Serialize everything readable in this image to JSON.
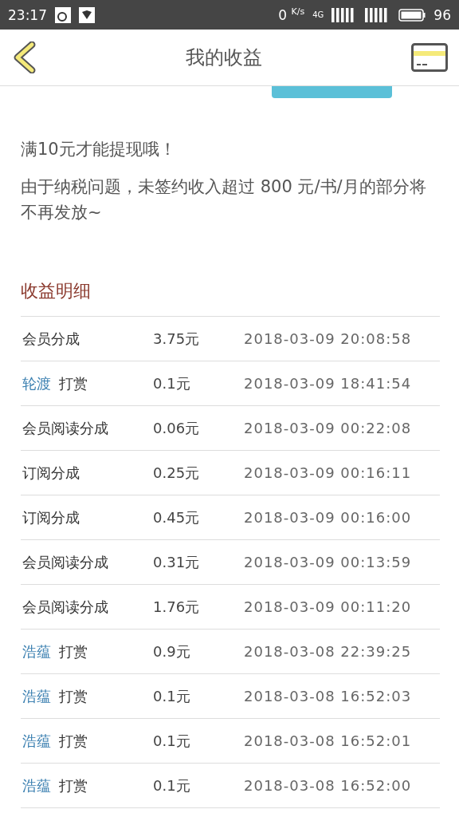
{
  "status_bar": {
    "time": "23:17",
    "speed": "0",
    "speed_unit": "K/s",
    "network": "4G",
    "battery": "96"
  },
  "header": {
    "title": "我的收益"
  },
  "notes": [
    "满10元才能提现哦！",
    "由于纳税问题，未签约收入超过 800 元/书/月的部分将不再发放~"
  ],
  "section_title": "收益明细",
  "rows": [
    {
      "kind": "plain",
      "label": "会员分成",
      "amount": "3.75元",
      "time": "2018-03-09 20:08:58"
    },
    {
      "kind": "reward",
      "user": "轮渡",
      "label": "打赏",
      "amount": "0.1元",
      "time": "2018-03-09 18:41:54"
    },
    {
      "kind": "plain",
      "label": "会员阅读分成",
      "amount": "0.06元",
      "time": "2018-03-09 00:22:08"
    },
    {
      "kind": "plain",
      "label": "订阅分成",
      "amount": "0.25元",
      "time": "2018-03-09 00:16:11"
    },
    {
      "kind": "plain",
      "label": "订阅分成",
      "amount": "0.45元",
      "time": "2018-03-09 00:16:00"
    },
    {
      "kind": "plain",
      "label": "会员阅读分成",
      "amount": "0.31元",
      "time": "2018-03-09 00:13:59"
    },
    {
      "kind": "plain",
      "label": "会员阅读分成",
      "amount": "1.76元",
      "time": "2018-03-09 00:11:20"
    },
    {
      "kind": "reward",
      "user": "浩蕴",
      "label": "打赏",
      "amount": "0.9元",
      "time": "2018-03-08 22:39:25"
    },
    {
      "kind": "reward",
      "user": "浩蕴",
      "label": "打赏",
      "amount": "0.1元",
      "time": "2018-03-08 16:52:03"
    },
    {
      "kind": "reward",
      "user": "浩蕴",
      "label": "打赏",
      "amount": "0.1元",
      "time": "2018-03-08 16:52:01"
    },
    {
      "kind": "reward",
      "user": "浩蕴",
      "label": "打赏",
      "amount": "0.1元",
      "time": "2018-03-08 16:52:00"
    }
  ]
}
